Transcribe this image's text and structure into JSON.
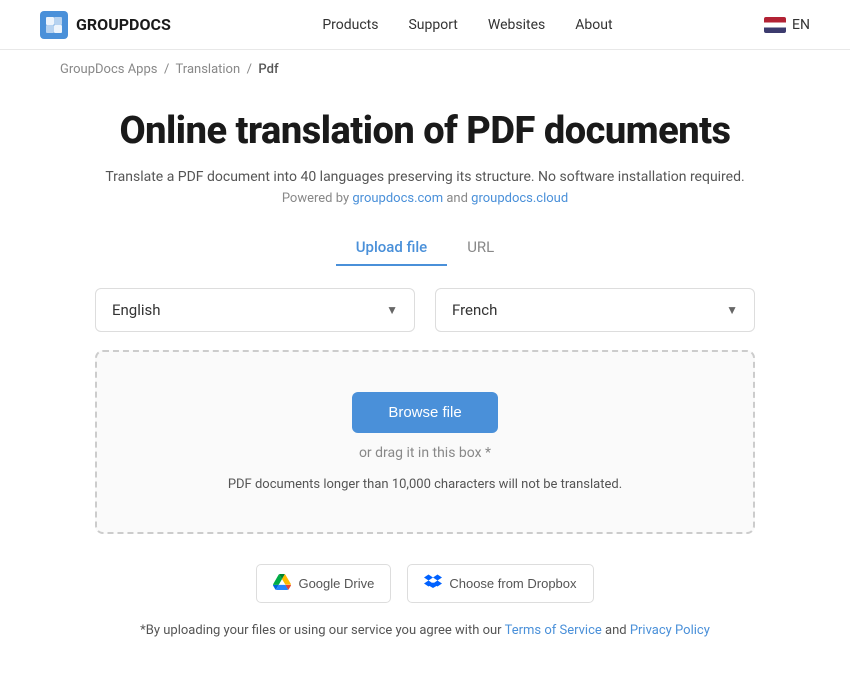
{
  "header": {
    "logo_text": "GROUPDOCS",
    "nav": [
      {
        "label": "Products",
        "href": "#"
      },
      {
        "label": "Support",
        "href": "#"
      },
      {
        "label": "Websites",
        "href": "#"
      },
      {
        "label": "About",
        "href": "#"
      }
    ],
    "lang_code": "EN"
  },
  "breadcrumb": {
    "items": [
      {
        "label": "GroupDocs Apps",
        "href": "#"
      },
      {
        "label": "Translation",
        "href": "#"
      },
      {
        "label": "Pdf",
        "href": null
      }
    ]
  },
  "main": {
    "page_title": "Online translation of PDF documents",
    "subtitle": "Translate a PDF document into 40 languages preserving its structure. No software installation required.",
    "powered_by_prefix": "Powered by ",
    "powered_by_link1": "groupdocs.com",
    "powered_by_and": " and ",
    "powered_by_link2": "groupdocs.cloud",
    "tabs": [
      {
        "label": "Upload file",
        "active": true
      },
      {
        "label": "URL",
        "active": false
      }
    ],
    "source_language": "English",
    "target_language": "French",
    "browse_btn_label": "Browse file",
    "drag_text": "or drag it in this box *",
    "limit_text": "PDF documents longer than 10,000 characters will not be translated.",
    "google_drive_label": "Google Drive",
    "dropbox_label": "Choose from Dropbox",
    "footer_notice_start": "*By uploading your files or using our service you agree with our ",
    "footer_tos_label": "Terms of Service",
    "footer_notice_and": " and ",
    "footer_privacy_label": "Privacy Policy"
  },
  "colors": {
    "accent": "#4a90d9",
    "text_primary": "#1a1a1a",
    "text_secondary": "#555",
    "text_muted": "#888",
    "border": "#ddd",
    "dashed_border": "#ccc"
  }
}
